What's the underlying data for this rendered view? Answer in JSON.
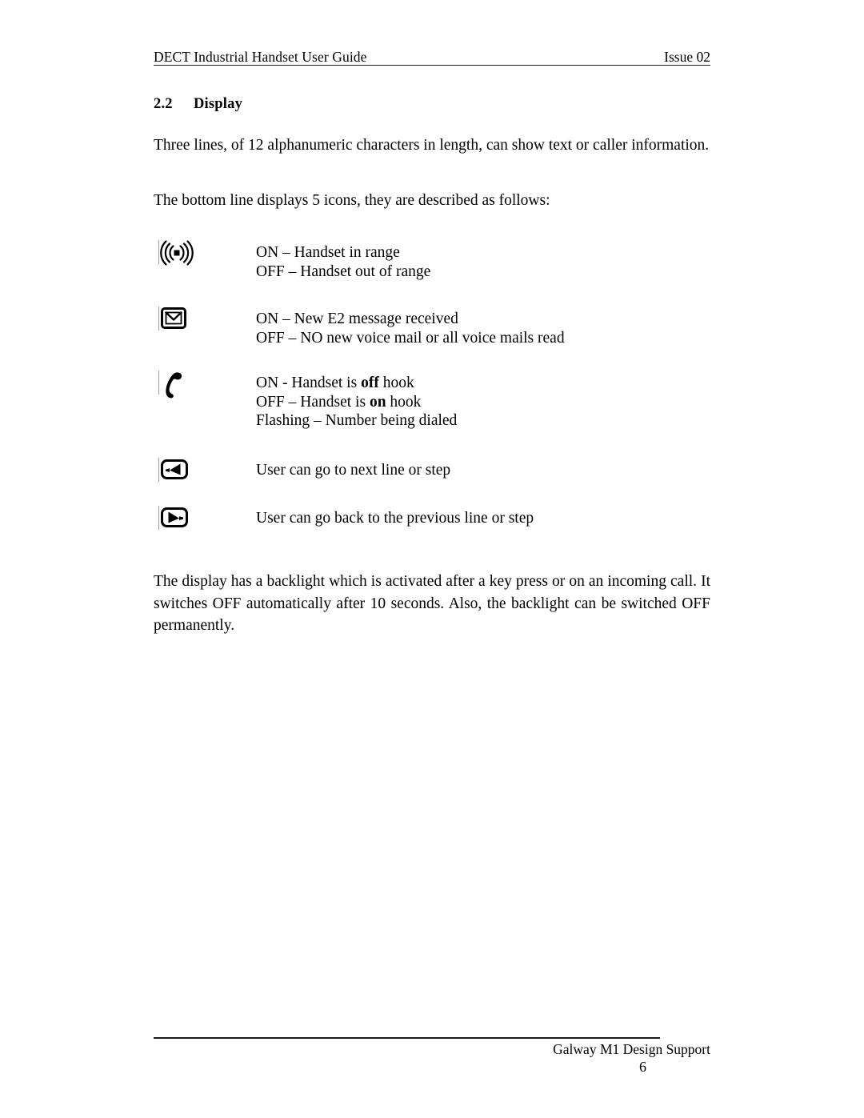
{
  "header": {
    "left_text": "DECT Industrial Handset User Guide",
    "right_text": "Issue 02"
  },
  "section": {
    "number": "2.2",
    "title": "Display"
  },
  "paragraphs": {
    "intro": "Three lines, of 12 alphanumeric characters in length, can show text or caller information.",
    "bottom_line": "The bottom line displays 5 icons, they are described as follows:",
    "backlight": "The display has a backlight which is activated after a key press or on an incoming call. It switches OFF automatically after 10 seconds. Also, the backlight can be switched OFF permanently."
  },
  "icon_rows": [
    {
      "icon": "signal-range-icon",
      "lines": [
        {
          "prefix": "ON – Handset in range",
          "bold": "",
          "suffix": ""
        },
        {
          "prefix": "OFF – Handset out of range",
          "bold": "",
          "suffix": ""
        }
      ]
    },
    {
      "icon": "envelope-message-icon",
      "lines": [
        {
          "prefix": "ON – New E2 message received",
          "bold": "",
          "suffix": ""
        },
        {
          "prefix": "OFF – NO new voice mail or all voice mails read",
          "bold": "",
          "suffix": ""
        }
      ]
    },
    {
      "icon": "phone-handset-icon",
      "lines": [
        {
          "prefix": "ON - Handset is ",
          "bold": "off",
          "suffix": " hook"
        },
        {
          "prefix": "OFF – Handset is ",
          "bold": "on",
          "suffix": " hook"
        },
        {
          "prefix": "Flashing – Number being dialed",
          "bold": "",
          "suffix": ""
        }
      ]
    },
    {
      "icon": "arrow-left-key-icon",
      "lines": [
        {
          "prefix": "User can go to next line or step",
          "bold": "",
          "suffix": ""
        }
      ]
    },
    {
      "icon": "arrow-right-key-icon",
      "lines": [
        {
          "prefix": "User can go back to the previous line or step",
          "bold": "",
          "suffix": ""
        }
      ]
    }
  ],
  "footer": {
    "company": "Galway M1 Design Support",
    "page_number": "6"
  },
  "colors": {
    "text": "#000000",
    "rule": "#1a1a1a",
    "page_background": "#ffffff"
  }
}
